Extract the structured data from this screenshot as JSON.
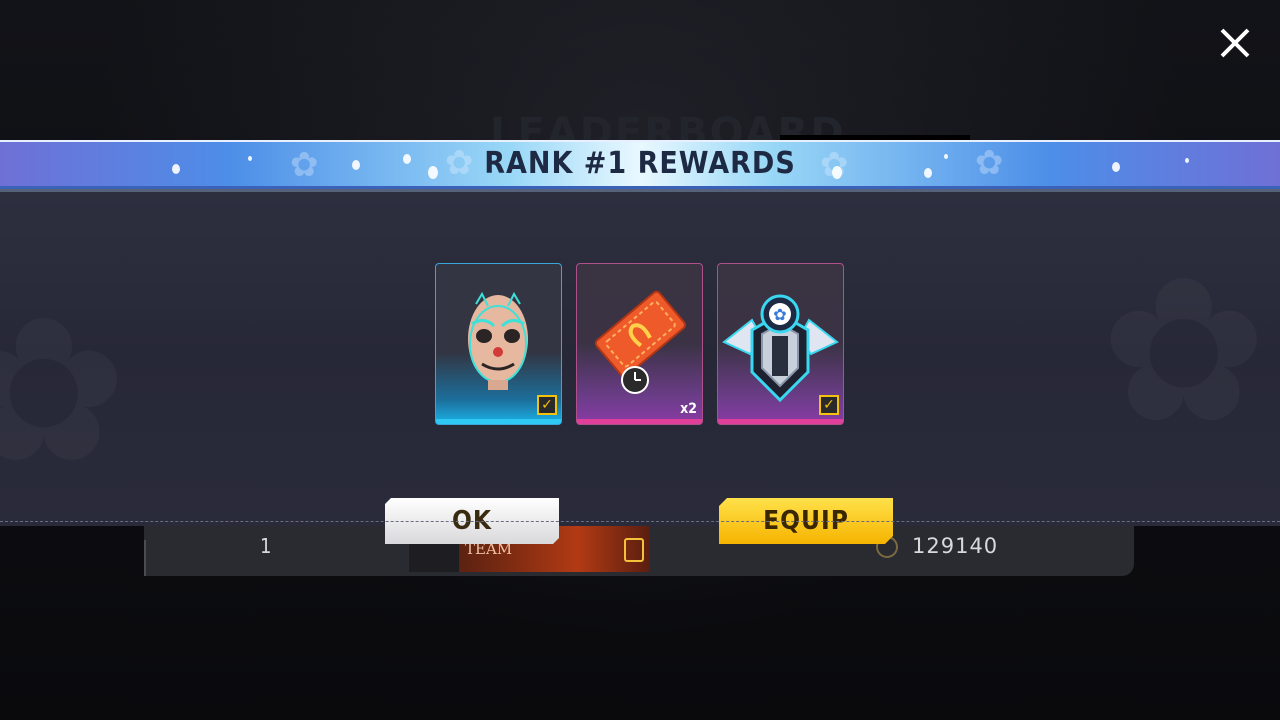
{
  "modal": {
    "title": "RANK #1 REWARDS",
    "rewards": [
      {
        "name": "clown-mask",
        "icon": "clown-mask-icon",
        "equipped": true
      },
      {
        "name": "ticket",
        "icon": "ticket-icon",
        "quantity": "x2",
        "timed": true
      },
      {
        "name": "emblem",
        "icon": "emblem-icon",
        "equipped": true
      }
    ],
    "ok_label": "OK",
    "equip_label": "EQUIP"
  },
  "background": {
    "title": "LEADERBOARD",
    "row": {
      "rank": "1",
      "team_name": "TEAM",
      "score": "129140"
    }
  },
  "colors": {
    "accent_yellow": "#f6b400",
    "card_blue": "#1bb3e8",
    "card_pink": "#e0409a"
  }
}
